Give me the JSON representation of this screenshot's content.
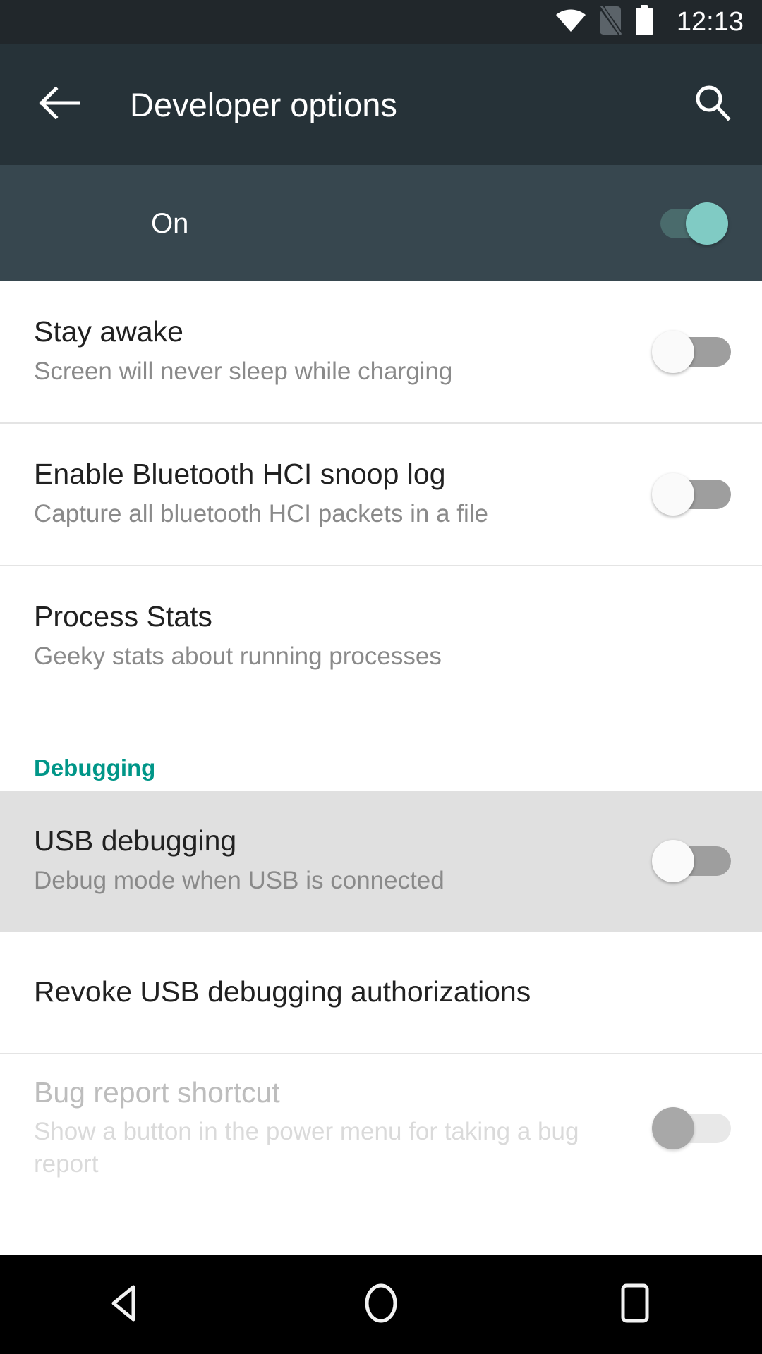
{
  "status_bar": {
    "time": "12:13",
    "icons": [
      "wifi-icon",
      "no-sim-icon",
      "battery-full-icon"
    ]
  },
  "action_bar": {
    "back_icon": "arrow-back-icon",
    "title": "Developer options",
    "search_icon": "search-icon"
  },
  "master_switch": {
    "label": "On",
    "state": "on"
  },
  "settings": [
    {
      "id": "stay-awake",
      "title": "Stay awake",
      "summary": "Screen will never sleep while charging",
      "toggle": "off",
      "enabled": true,
      "highlighted": false
    },
    {
      "id": "bluetooth-hci-snoop-log",
      "title": "Enable Bluetooth HCI snoop log",
      "summary": "Capture all bluetooth HCI packets in a file",
      "toggle": "off",
      "enabled": true,
      "highlighted": false
    },
    {
      "id": "process-stats",
      "title": "Process Stats",
      "summary": "Geeky stats about running processes",
      "toggle": "none",
      "enabled": true,
      "highlighted": false
    }
  ],
  "debugging_section": {
    "header": "Debugging",
    "items": [
      {
        "id": "usb-debugging",
        "title": "USB debugging",
        "summary": "Debug mode when USB is connected",
        "toggle": "off",
        "enabled": true,
        "highlighted": true
      },
      {
        "id": "revoke-usb-debugging-authorizations",
        "title": "Revoke USB debugging authorizations",
        "summary": "",
        "toggle": "none",
        "enabled": true,
        "highlighted": false
      },
      {
        "id": "bug-report-shortcut",
        "title": "Bug report shortcut",
        "summary": "Show a button in the power menu for taking a bug report",
        "toggle": "disabled",
        "enabled": false,
        "highlighted": false
      }
    ]
  },
  "nav_bar": {
    "back": "nav-back-icon",
    "home": "nav-home-icon",
    "recents": "nav-recents-icon"
  },
  "colors": {
    "status_bar_bg": "#21272b",
    "action_bar_bg": "#263238",
    "switch_bar_bg": "#37474f",
    "accent_teal": "#009688",
    "toggle_on_thumb": "#80cbc4",
    "toggle_off_track": "#9e9e9e",
    "row_highlight": "#e0e0e0",
    "nav_bar_bg": "#000000"
  }
}
